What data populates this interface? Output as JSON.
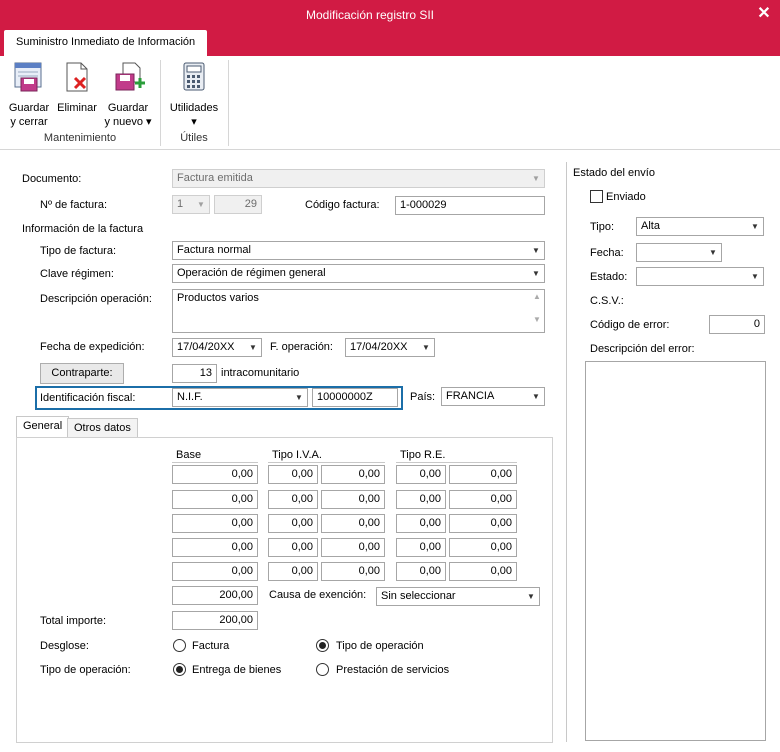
{
  "window": {
    "title": "Modificación registro SII",
    "close_glyph": "✕"
  },
  "ribbon": {
    "tab_label": "Suministro Inmediato de Información",
    "buttons": {
      "guardar_cerrar": [
        "Guardar",
        "y cerrar"
      ],
      "eliminar": "Eliminar",
      "guardar_nuevo": [
        "Guardar",
        "y nuevo ▾"
      ],
      "utilidades": "Utilidades",
      "utilidades_arrow": "▾"
    },
    "groups": {
      "mantenimiento": "Mantenimiento",
      "utiles": "Útiles"
    }
  },
  "form": {
    "documento": {
      "label": "Documento:",
      "value": "Factura emitida"
    },
    "num_factura": {
      "label": "Nº de factura:",
      "serie": "1",
      "numero": "29"
    },
    "codigo_factura": {
      "label": "Código factura:",
      "value": "1-000029"
    },
    "info_factura_heading": "Información de la factura",
    "tipo_factura": {
      "label": "Tipo de factura:",
      "value": "Factura normal"
    },
    "clave_regimen": {
      "label": "Clave régimen:",
      "value": "Operación de régimen general"
    },
    "descripcion": {
      "label": "Descripción operación:",
      "value": "Productos varios"
    },
    "fecha_expedicion": {
      "label": "Fecha de expedición:",
      "value": "17/04/20XX"
    },
    "f_operacion": {
      "label": "F. operación:",
      "value": "17/04/20XX"
    },
    "contraparte": {
      "button": "Contraparte:",
      "number": "13",
      "text": "intracomunitario"
    },
    "identificacion_fiscal": {
      "label": "Identificación fiscal:",
      "tipo": "N.I.F.",
      "valor": "10000000Z"
    },
    "pais": {
      "label": "País:",
      "value": "FRANCIA"
    }
  },
  "tabs": {
    "general": "General",
    "otros": "Otros datos"
  },
  "table": {
    "headers": {
      "base": "Base",
      "iva": "Tipo I.V.A.",
      "re": "Tipo R.E."
    },
    "rows": [
      [
        "0,00",
        "0,00",
        "0,00",
        "0,00",
        "0,00"
      ],
      [
        "0,00",
        "0,00",
        "0,00",
        "0,00",
        "0,00"
      ],
      [
        "0,00",
        "0,00",
        "0,00",
        "0,00",
        "0,00"
      ],
      [
        "0,00",
        "0,00",
        "0,00",
        "0,00",
        "0,00"
      ],
      [
        "0,00",
        "0,00",
        "0,00",
        "0,00",
        "0,00"
      ]
    ],
    "subtotal": "200,00",
    "causa_exencion": {
      "label": "Causa de exención:",
      "value": "Sin seleccionar"
    },
    "total_importe": {
      "label": "Total importe:",
      "value": "200,00"
    },
    "desglose": {
      "label": "Desglose:",
      "factura": "Factura",
      "tipo_operacion": "Tipo de operación"
    },
    "tipo_operacion": {
      "label": "Tipo de operación:",
      "entrega": "Entrega de bienes",
      "prestacion": "Prestación de servicios"
    }
  },
  "estado_envio": {
    "heading": "Estado del envío",
    "enviado": "Enviado",
    "tipo": {
      "label": "Tipo:",
      "value": "Alta"
    },
    "fecha": {
      "label": "Fecha:",
      "value": ""
    },
    "estado": {
      "label": "Estado:",
      "value": ""
    },
    "csv": {
      "label": "C.S.V.:"
    },
    "codigo_error": {
      "label": "Código de error:",
      "value": "0"
    },
    "descripcion_error": {
      "label": "Descripción del error:"
    }
  },
  "colors": {
    "title_bar": "#d11b44",
    "highlight_border": "#1b6ea8"
  }
}
